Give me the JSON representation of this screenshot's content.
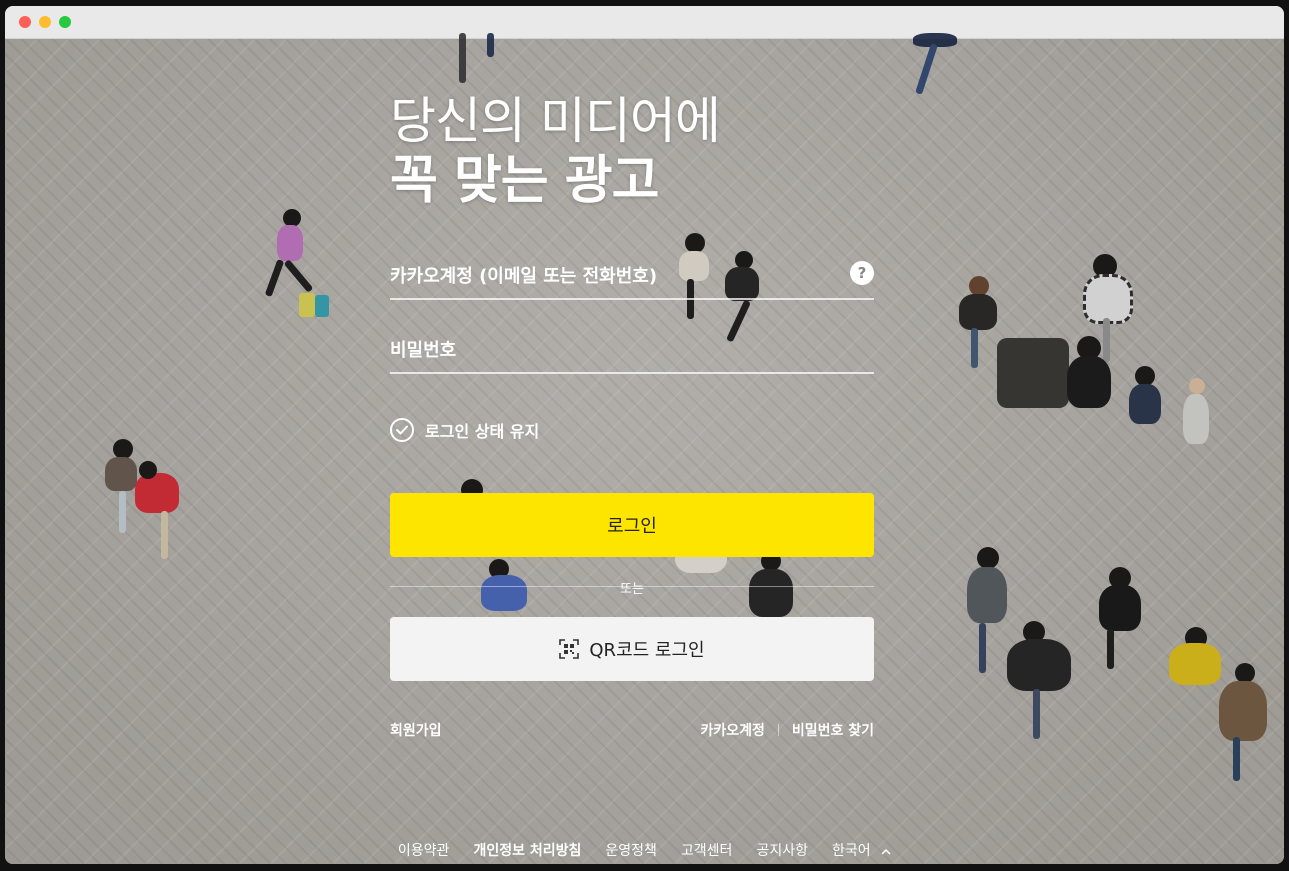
{
  "headline": {
    "line1": "당신의 미디어에",
    "line2": "꼭 맞는 광고"
  },
  "form": {
    "account_placeholder": "카카오계정 (이메일 또는 전화번호)",
    "password_placeholder": "비밀번호",
    "help_glyph": "?",
    "keep_login_label": "로그인 상태 유지",
    "keep_login_checked": true,
    "login_button": "로그인",
    "divider_label": "또는",
    "qr_button": "QR코드 로그인"
  },
  "links": {
    "signup": "회원가입",
    "kakao_account": "카카오계정",
    "find_password": "비밀번호 찾기"
  },
  "footer": {
    "items": [
      "이용약관",
      "개인정보 처리방침",
      "운영정책",
      "고객센터",
      "공지사항"
    ],
    "language": "한국어"
  },
  "colors": {
    "login_button": "#fee500",
    "qr_button": "#f3f3f3",
    "text_light": "#ffffff"
  }
}
